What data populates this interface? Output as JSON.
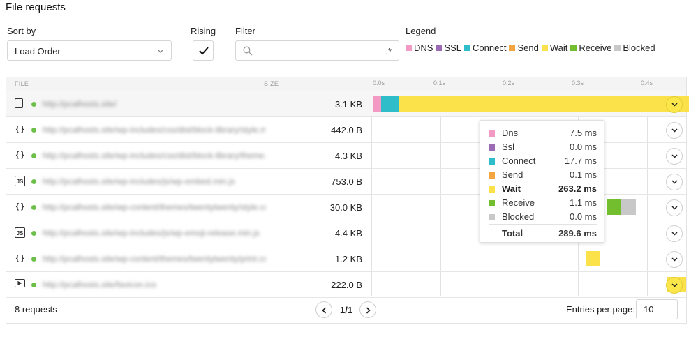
{
  "page": {
    "title": "File requests"
  },
  "controls": {
    "sort_label": "Sort by",
    "sort_value": "Load Order",
    "rising_label": "Rising",
    "rising_checked": true,
    "filter_label": "Filter",
    "filter_value": "",
    "filter_regex_hint": ".*",
    "legend_label": "Legend"
  },
  "legend": [
    {
      "name": "DNS",
      "color": "#f29ac3"
    },
    {
      "name": "SSL",
      "color": "#9b6bb5"
    },
    {
      "name": "Connect",
      "color": "#2fbdc9"
    },
    {
      "name": "Send",
      "color": "#f2a541"
    },
    {
      "name": "Wait",
      "color": "#fbe14a"
    },
    {
      "name": "Receive",
      "color": "#72be2f"
    },
    {
      "name": "Blocked",
      "color": "#c8c8c8"
    }
  ],
  "table": {
    "col_file": "FILE",
    "col_size": "SIZE",
    "ticks": [
      "0.0s",
      "0.1s",
      "0.2s",
      "0.3s",
      "0.4s"
    ],
    "rows": [
      {
        "icon": "document-icon",
        "glyph": "▭",
        "url": "http://pcalhosts.site/",
        "size": "3.1 KB"
      },
      {
        "icon": "json-icon",
        "glyph": "{ }",
        "url": "http://pcalhosts.site/wp-includes/css/dist/block-library/style.min.css",
        "size": "442.0 B"
      },
      {
        "icon": "json-icon",
        "glyph": "{ }",
        "url": "http://pcalhosts.site/wp-includes/css/dist/block-library/theme.min.css",
        "size": "4.3 KB"
      },
      {
        "icon": "js-icon",
        "glyph": "JS",
        "url": "http://pcalhosts.site/wp-includes/js/wp-embed.min.js",
        "size": "753.0 B"
      },
      {
        "icon": "json-icon",
        "glyph": "{ }",
        "url": "http://pcalhosts.site/wp-content/themes/twentytwenty/style.css",
        "size": "30.0 KB"
      },
      {
        "icon": "js-icon",
        "glyph": "JS",
        "url": "http://pcalhosts.site/wp-includes/js/wp-emoji-release.min.js",
        "size": "4.4 KB"
      },
      {
        "icon": "json-icon",
        "glyph": "{ }",
        "url": "http://pcalhosts.site/wp-content/themes/twentytwenty/print.css",
        "size": "1.2 KB"
      },
      {
        "icon": "media-icon",
        "glyph": "▶",
        "url": "http://pcalhosts.site/favicon.ico",
        "size": "222.0 B"
      }
    ]
  },
  "tooltip": {
    "items": [
      {
        "name": "Dns",
        "value": "7.5 ms",
        "color": "#f29ac3"
      },
      {
        "name": "Ssl",
        "value": "0.0 ms",
        "color": "#9b6bb5"
      },
      {
        "name": "Connect",
        "value": "17.7 ms",
        "color": "#2fbdc9"
      },
      {
        "name": "Send",
        "value": "0.1 ms",
        "color": "#f2a541"
      },
      {
        "name": "Wait",
        "value": "263.2 ms",
        "color": "#fbe14a"
      },
      {
        "name": "Receive",
        "value": "1.1 ms",
        "color": "#72be2f"
      },
      {
        "name": "Blocked",
        "value": "0.0 ms",
        "color": "#c8c8c8"
      }
    ],
    "total_label": "Total",
    "total_value": "289.6 ms"
  },
  "footer": {
    "count": "8 requests",
    "pagination": "1/1",
    "entries_label": "Entries per page:",
    "entries_value": "10"
  }
}
